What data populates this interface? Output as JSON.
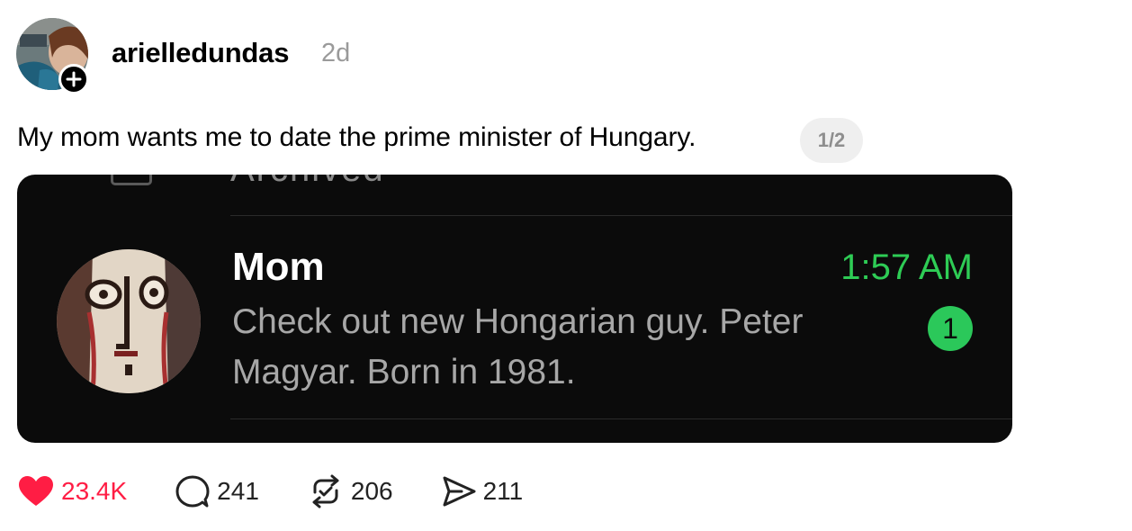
{
  "post": {
    "username": "arielledundas",
    "time_ago": "2d",
    "caption": "My mom wants me to date the prime minister of Hungary.",
    "page_indicator": "1/2"
  },
  "screenshot": {
    "clipped_header": "Archived",
    "contact_name": "Mom",
    "time": "1:57 AM",
    "message_preview": "Check out new Hongarian guy. Peter Magyar. Born in 1981.",
    "unread_count": "1",
    "accent_color": "#2ecc55"
  },
  "actions": {
    "likes": "23.4K",
    "comments": "241",
    "reposts": "206",
    "shares": "211"
  },
  "icons": {
    "like": "heart-icon",
    "comment": "comment-icon",
    "repost": "repost-icon",
    "share": "send-icon",
    "follow": "plus-icon"
  },
  "colors": {
    "like_red": "#ff1d44",
    "muted_gray": "#9a9a9a",
    "card_bg": "#0b0b0b"
  }
}
